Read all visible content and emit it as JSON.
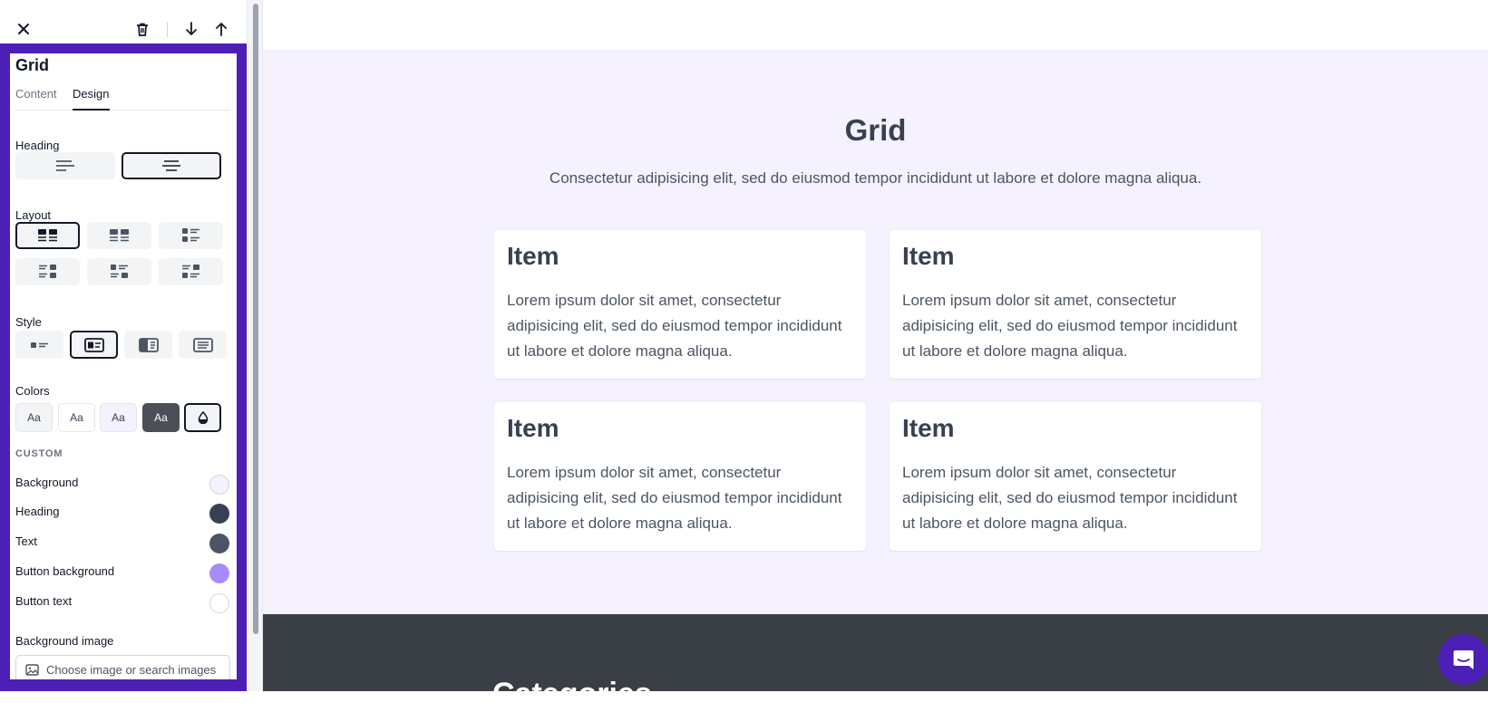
{
  "toolbar": {
    "close_icon": "close-icon",
    "delete_icon": "trash-icon",
    "move_down_icon": "arrow-down-icon",
    "move_up_icon": "arrow-up-icon"
  },
  "panel": {
    "title": "Grid",
    "tabs": [
      {
        "label": "Content",
        "active": false
      },
      {
        "label": "Design",
        "active": true
      }
    ],
    "heading_section": {
      "label": "Heading",
      "options": [
        {
          "icon": "align-left-icon",
          "selected": false
        },
        {
          "icon": "align-center-icon",
          "selected": true
        }
      ]
    },
    "layout_section": {
      "label": "Layout",
      "options": [
        {
          "icon": "layout-2col-icon",
          "selected": true
        },
        {
          "icon": "layout-2col-alt-icon",
          "selected": false
        },
        {
          "icon": "layout-list-icon",
          "selected": false
        },
        {
          "icon": "layout-list-alt-icon",
          "selected": false
        },
        {
          "icon": "layout-grid-icon",
          "selected": false
        },
        {
          "icon": "layout-grid-alt-icon",
          "selected": false
        }
      ]
    },
    "style_section": {
      "label": "Style",
      "options": [
        {
          "icon": "style-plain-icon",
          "selected": false
        },
        {
          "icon": "style-card-icon",
          "selected": true
        },
        {
          "icon": "style-split-icon",
          "selected": false
        },
        {
          "icon": "style-boxed-icon",
          "selected": false
        }
      ]
    },
    "colors_section": {
      "label": "Colors",
      "options": [
        {
          "label": "Aa",
          "bg": "#f3f4f6",
          "fg": "#374151",
          "selected": false
        },
        {
          "label": "Aa",
          "bg": "#ffffff",
          "fg": "#374151",
          "selected": false
        },
        {
          "label": "Aa",
          "bg": "#f5f1fe",
          "fg": "#374151",
          "selected": false
        },
        {
          "label": "Aa",
          "bg": "#4b5058",
          "fg": "#ffffff",
          "selected": false
        },
        {
          "icon": "color-drop-icon",
          "selected": true
        }
      ]
    },
    "custom": {
      "label": "CUSTOM",
      "rows": [
        {
          "label": "Background",
          "color": "#f5f1fe"
        },
        {
          "label": "Heading",
          "color": "#374151"
        },
        {
          "label": "Text",
          "color": "#4b5563"
        },
        {
          "label": "Button background",
          "color": "#a78bfa"
        },
        {
          "label": "Button text",
          "color": "#ffffff"
        }
      ]
    },
    "background_image": {
      "label": "Background image",
      "placeholder": "Choose image or search images"
    }
  },
  "canvas": {
    "grid_heading": "Grid",
    "grid_subtitle": "Consectetur adipisicing elit, sed do eiusmod tempor incididunt ut labore et dolore magna aliqua.",
    "items": [
      {
        "title": "Item",
        "text": "Lorem ipsum dolor sit amet, consectetur adipisicing elit, sed do eiusmod tempor incididunt ut labore et dolore magna aliqua."
      },
      {
        "title": "Item",
        "text": "Lorem ipsum dolor sit amet, consectetur adipisicing elit, sed do eiusmod tempor incididunt ut labore et dolore magna aliqua."
      },
      {
        "title": "Item",
        "text": "Lorem ipsum dolor sit amet, consectetur adipisicing elit, sed do eiusmod tempor incididunt ut labore et dolore magna aliqua."
      },
      {
        "title": "Item",
        "text": "Lorem ipsum dolor sit amet, consectetur adipisicing elit, sed do eiusmod tempor incididunt ut labore et dolore magna aliqua."
      }
    ],
    "next_section_heading": "Categories",
    "colors": {
      "section_bg": "#f5f1fe",
      "dark_bg": "#3a3e45",
      "accent": "#4c1fb7"
    }
  },
  "chat": {
    "icon": "chat-icon"
  }
}
